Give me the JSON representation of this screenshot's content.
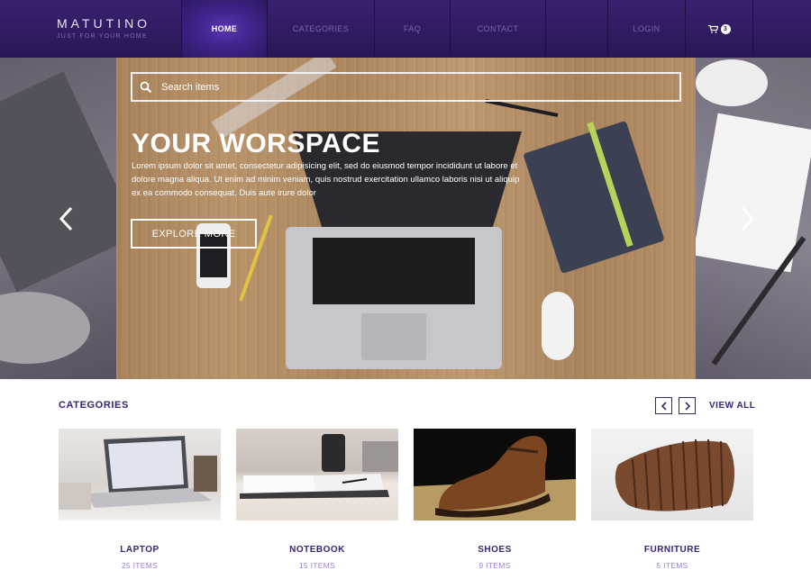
{
  "brand": {
    "name": "MATUTINO",
    "tagline": "JUST FOR YOUR HOME"
  },
  "nav": {
    "items": [
      "HOME",
      "CATEGORIES",
      "FAQ",
      "CONTACT",
      "LOGIN"
    ],
    "active": "HOME",
    "cart_count": "3",
    "cart_icon": "cart-icon"
  },
  "hero": {
    "search_placeholder": "Search items",
    "title": "YOUR WORSPACE",
    "text": "Lorem ipsum dolor sit amet, consectetur adipisicing elit, sed do eiusmod tempor incididunt ut labore et dolore magna aliqua. Ut enim ad minim veniam, quis nostrud exercitation ullamco laboris nisi ut aliquip ex ea commodo consequat. Duis aute irure dolor",
    "cta": "EXPLORE MORE"
  },
  "categories": {
    "title": "CATEGORIES",
    "view_all": "VIEW ALL",
    "items": [
      {
        "name": "LAPTOP",
        "count": "25 ITEMS"
      },
      {
        "name": "NOTEBOOK",
        "count": "15 ITEMS"
      },
      {
        "name": "SHOES",
        "count": "9 ITEMS"
      },
      {
        "name": "FURNITURE",
        "count": "5 ITEMS"
      }
    ]
  },
  "colors": {
    "nav_bg": "#2a1656",
    "nav_active": "#4a2a9c",
    "primary_text": "#3a2470",
    "count_text": "#9a7ed6"
  }
}
